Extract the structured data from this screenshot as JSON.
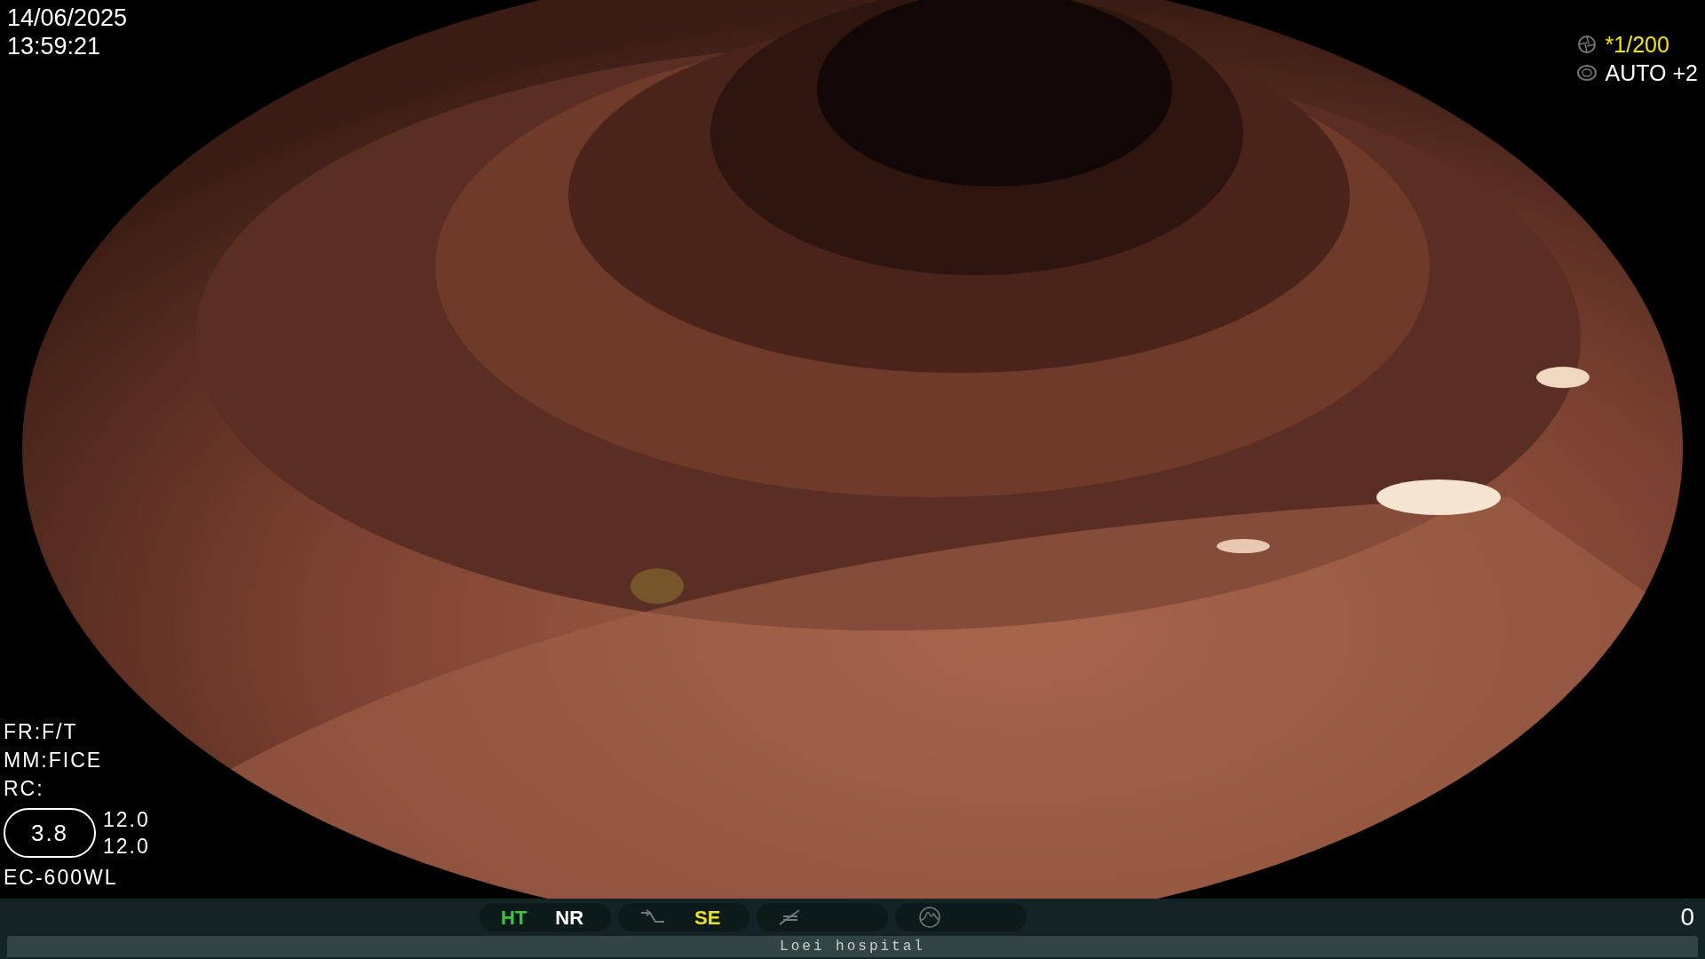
{
  "date": "14/06/2025",
  "time": "13:59:21",
  "camera": [
    {
      "kind": "shutter",
      "text": "*1/200",
      "color": "#f2e600"
    },
    {
      "kind": "iris",
      "text": "AUTO +2",
      "color": "#ffffff"
    }
  ],
  "info_lines": [
    "FR:F/T",
    "MM:FICE",
    "RC:"
  ],
  "gauge": {
    "value": "3.8",
    "readings": [
      "12.0",
      "12.0"
    ]
  },
  "scope": "EC-600WL",
  "status_groups": [
    {
      "items": [
        {
          "kind": "text",
          "text": "HT",
          "color": "#3ec43e"
        },
        {
          "kind": "text",
          "text": "NR",
          "color": "#ffffff"
        }
      ]
    },
    {
      "items": [
        {
          "kind": "curve"
        },
        {
          "kind": "text",
          "text": "SE",
          "color": "#e8e030"
        }
      ]
    },
    {
      "items": [
        {
          "kind": "slash"
        }
      ]
    },
    {
      "items": [
        {
          "kind": "wave"
        }
      ]
    }
  ],
  "counter": "0",
  "footer": "Loei hospital"
}
